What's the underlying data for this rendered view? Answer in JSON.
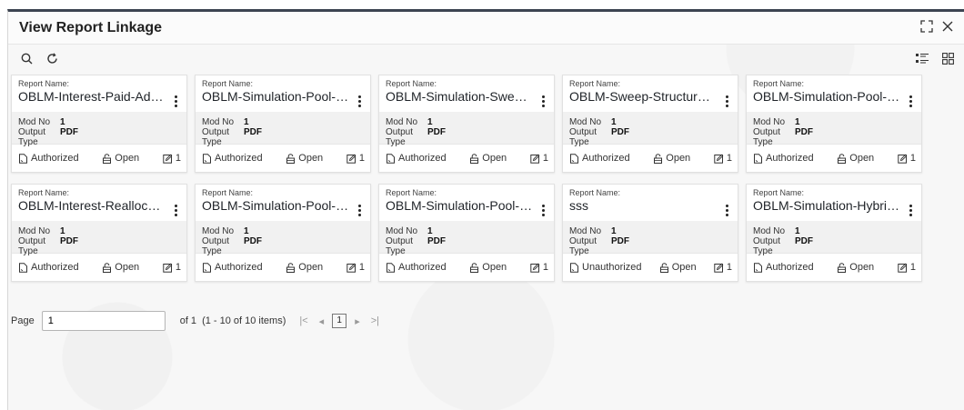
{
  "window": {
    "title": "View Report Linkage"
  },
  "toolbar": {
    "search_icon": "search-icon",
    "refresh_icon": "refresh-icon",
    "list_view_icon": "list-view-icon",
    "grid_view_icon": "grid-view-icon"
  },
  "labels": {
    "report_name": "Report Name:",
    "mod_no": "Mod No",
    "output_type": "Output Type",
    "open": "Open"
  },
  "cards": [
    {
      "name": "OBLM-Interest-Paid-Advice",
      "mod_no": "1",
      "output_type": "PDF",
      "status": "Authorized",
      "edit_count": "1"
    },
    {
      "name": "OBLM-Simulation-Pool-IO...",
      "mod_no": "1",
      "output_type": "PDF",
      "status": "Authorized",
      "edit_count": "1"
    },
    {
      "name": "OBLM-Simulation-Sweep-...",
      "mod_no": "1",
      "output_type": "PDF",
      "status": "Authorized",
      "edit_count": "1"
    },
    {
      "name": "OBLM-Sweep-Structure-A...",
      "mod_no": "1",
      "output_type": "PDF",
      "status": "Authorized",
      "edit_count": "1"
    },
    {
      "name": "OBLM-Simulation-Pool-A...",
      "mod_no": "1",
      "output_type": "PDF",
      "status": "Authorized",
      "edit_count": "1"
    },
    {
      "name": "OBLM-Interest-Reallocati...",
      "mod_no": "1",
      "output_type": "PDF",
      "status": "Authorized",
      "edit_count": "1"
    },
    {
      "name": "OBLM-Simulation-Pool-R...",
      "mod_no": "1",
      "output_type": "PDF",
      "status": "Authorized",
      "edit_count": "1"
    },
    {
      "name": "OBLM-Simulation-Pool-A...",
      "mod_no": "1",
      "output_type": "PDF",
      "status": "Authorized",
      "edit_count": "1"
    },
    {
      "name": "sss",
      "mod_no": "1",
      "output_type": "PDF",
      "status": "Unauthorized",
      "edit_count": "1"
    },
    {
      "name": "OBLM-Simulation-Hybrid...",
      "mod_no": "1",
      "output_type": "PDF",
      "status": "Authorized",
      "edit_count": "1"
    }
  ],
  "pager": {
    "page_label": "Page",
    "page_value": "1",
    "of_label": "of 1",
    "items_label": "(1 - 10 of 10 items)",
    "current_page": "1",
    "first": "|<",
    "prev": "◂",
    "next": "▸",
    "last": ">|"
  },
  "colors": {
    "header_bar": "#3c4451",
    "card_body_bg": "#f1f1f1",
    "text": "#1f2328"
  }
}
